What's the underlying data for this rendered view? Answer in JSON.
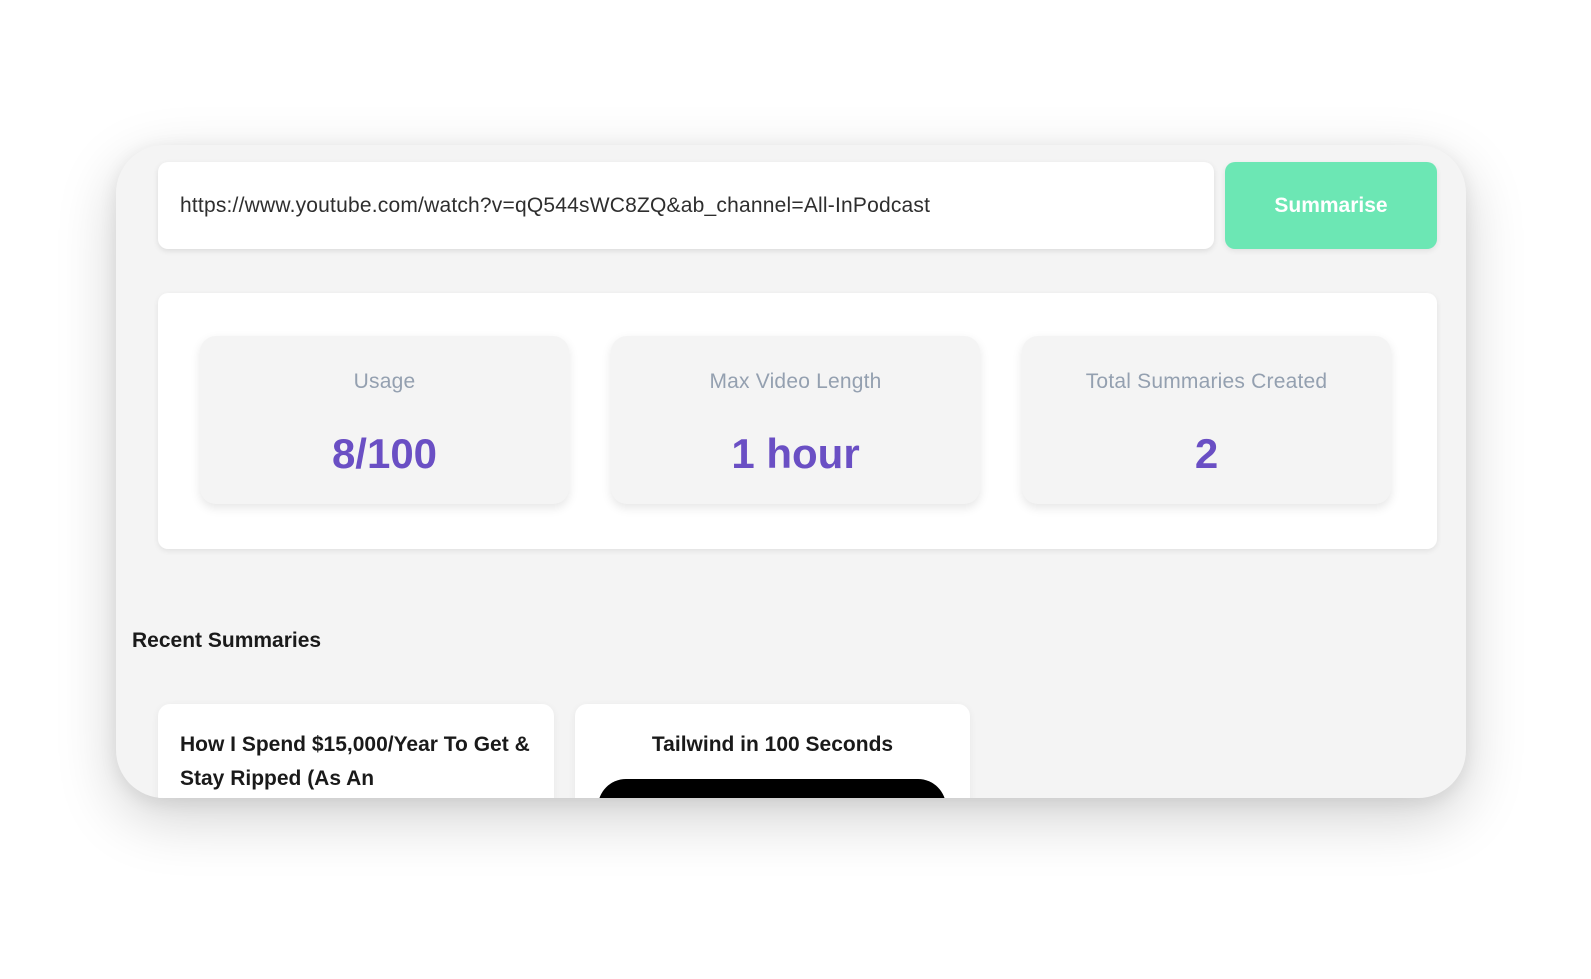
{
  "search": {
    "url_value": "https://www.youtube.com/watch?v=qQ544sWC8ZQ&ab_channel=All-InPodcast",
    "button_label": "Summarise"
  },
  "stats": [
    {
      "label": "Usage",
      "value": "8/100"
    },
    {
      "label": "Max Video Length",
      "value": "1 hour"
    },
    {
      "label": "Total Summaries Created",
      "value": "2"
    }
  ],
  "recent": {
    "title": "Recent Summaries",
    "items": [
      {
        "title": "How I Spend $15,000/Year To Get & Stay Ripped (As An"
      },
      {
        "title": "Tailwind in 100 Seconds"
      }
    ]
  },
  "colors": {
    "accent_button": "#6ce7b4",
    "stat_value": "#6a4fc4",
    "stat_label": "#94a0b0",
    "background": "#f4f4f4"
  }
}
